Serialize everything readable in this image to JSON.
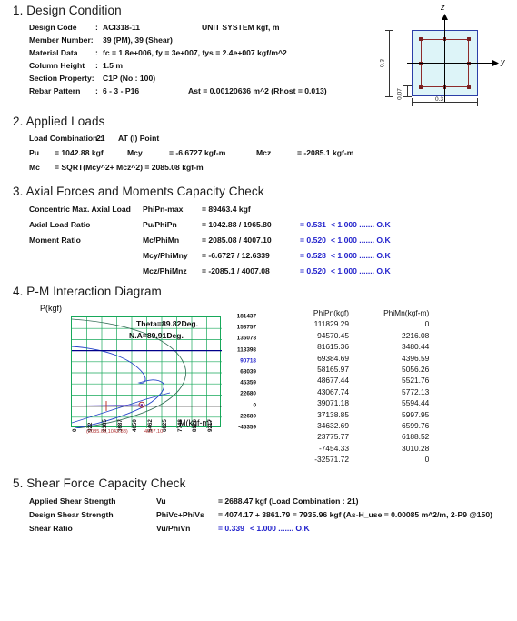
{
  "document": {
    "unit_system": "UNIT SYSTEM kgf, m"
  },
  "sections": {
    "design_condition": {
      "title": "1. Design Condition",
      "rows": [
        {
          "label": "Design Code",
          "sep": ":",
          "value": "ACI318-11"
        },
        {
          "label": "Member Number:",
          "sep": "",
          "value": "39 (PM), 39 (Shear)"
        },
        {
          "label": "Material Data",
          "sep": ":",
          "value": "fc = 1.8e+006,   fy = 3e+007,   fys = 2.4e+007 kgf/m^2"
        },
        {
          "label": "Column Height",
          "sep": ":",
          "value": "1.5 m"
        },
        {
          "label": "Section Property:",
          "sep": "",
          "value": "C1P (No : 100)"
        },
        {
          "label": "Rebar Pattern",
          "sep": ":",
          "value": "6 - 3 - P16"
        }
      ],
      "ast_text": "Ast = 0.00120636 m^2   (Rhost = 0.013)"
    },
    "applied_loads": {
      "title": "2. Applied Loads",
      "load_combination_label": "Load Combination :",
      "load_combination_value": "21",
      "at_point": "AT (I) Point",
      "pu_label": "Pu",
      "pu_value": "= 1042.88 kgf",
      "mcy_label": "Mcy",
      "mcy_value": "= -6.6727 kgf-m",
      "mcz_label": "Mcz",
      "mcz_value": "= -2085.1 kgf-m",
      "mc_label": "Mc",
      "mc_value": "= SQRT(Mcy^2+ Mcz^2) = 2085.08 kgf-m"
    },
    "axial_check": {
      "title": "3. Axial Forces and Moments Capacity Check",
      "rows": [
        {
          "label": "Concentric Max. Axial Load",
          "symbol": "PhiPn-max",
          "expr": "= 89463.4  kgf",
          "ratio": "",
          "verdict": ""
        },
        {
          "label": "Axial Load Ratio",
          "symbol": "Pu/PhiPn",
          "expr": "= 1042.88 / 1965.80",
          "ratio": "= 0.531",
          "verdict": "< 1.000 ....... O.K"
        },
        {
          "label": "Moment Ratio",
          "symbol": "Mc/PhiMn",
          "expr": "= 2085.08 / 4007.10",
          "ratio": "= 0.520",
          "verdict": "< 1.000 ....... O.K"
        },
        {
          "label": "",
          "symbol": "Mcy/PhiMny",
          "expr": "= -6.6727 / 12.6339",
          "ratio": "= 0.528",
          "verdict": "< 1.000 ....... O.K"
        },
        {
          "label": "",
          "symbol": "Mcz/PhiMnz",
          "expr": "= -2085.1 / 4007.08",
          "ratio": "= 0.520",
          "verdict": "< 1.000 ....... O.K"
        }
      ]
    },
    "pm_diagram": {
      "title": "4. P-M Interaction Diagram",
      "theta_note": "Theta=89.82Deg.",
      "na_note": "N.A=89.91Deg.",
      "point_label": "(2085.08,1042.88)",
      "capacity_label": "4007.10",
      "table_headers": [
        "PhiPn(kgf)",
        "PhiMn(kgf-m)"
      ]
    },
    "shear_check": {
      "title": "5. Shear Force Capacity Check",
      "rows": [
        {
          "label": "Applied Shear Strength",
          "symbol": "Vu",
          "value": "= 2688.47  kgf   (Load Combination :   21)",
          "ratio": "",
          "verdict": ""
        },
        {
          "label": "Design Shear Strength",
          "symbol": "PhiVc+PhiVs",
          "value": "= 4074.17 + 3861.79 = 7935.96  kgf  (As-H_use = 0.00085 m^2/m,  2-P9  @150)",
          "ratio": "",
          "verdict": ""
        },
        {
          "label": "Shear Ratio",
          "symbol": "Vu/PhiVn",
          "value": "",
          "ratio": "= 0.339",
          "verdict": "< 1.000 ....... O.K"
        }
      ]
    }
  },
  "section_figure": {
    "axis_z": "z",
    "axis_y": "y",
    "dim_height": "0.3",
    "dim_width": "0.3",
    "dim_cover": "0.07"
  },
  "chart_data": {
    "type": "line",
    "title": "P-M Interaction Diagram",
    "xlabel": "M(kgf-m)",
    "ylabel": "P(kgf)",
    "ylim": [
      -45359,
      181437
    ],
    "xlim": [
      0,
      9217
    ],
    "grid": true,
    "yticks": [
      181437,
      158757,
      136078,
      113398,
      90718,
      68039,
      45359,
      22680,
      0,
      -22680,
      -45359
    ],
    "ytick_labels": [
      "181437",
      "158757",
      "136078",
      "113398",
      "90718",
      "68039",
      "45359",
      "22680",
      "0",
      "-22680",
      "-45359"
    ],
    "xticks": [
      0,
      922,
      2185,
      3687,
      4650,
      5462,
      6825,
      7748,
      8926,
      9217
    ],
    "xtick_labels": [
      "0",
      "922",
      "2185",
      "3687",
      "4650",
      "5462",
      "6825",
      "7748",
      "8926",
      "9217"
    ],
    "annotations": [
      "Theta=89.82Deg.",
      "N.A=89.91Deg."
    ],
    "highlight_y": 89463.4,
    "demand_point": {
      "M": 2085.08,
      "P": 1042.88
    },
    "capacity_point": {
      "M": 4007.1,
      "P": 1042.88
    },
    "series": [
      {
        "name": "PhiPn-PhiMn",
        "points": [
          {
            "PhiPn": 111829.29,
            "PhiMn": 0.0
          },
          {
            "PhiPn": 94570.45,
            "PhiMn": 2216.08
          },
          {
            "PhiPn": 81615.36,
            "PhiMn": 3480.44
          },
          {
            "PhiPn": 69384.69,
            "PhiMn": 4396.59
          },
          {
            "PhiPn": 58165.97,
            "PhiMn": 5056.26
          },
          {
            "PhiPn": 48677.44,
            "PhiMn": 5521.76
          },
          {
            "PhiPn": 43067.74,
            "PhiMn": 5772.13
          },
          {
            "PhiPn": 39071.18,
            "PhiMn": 5594.44
          },
          {
            "PhiPn": 37138.85,
            "PhiMn": 5997.95
          },
          {
            "PhiPn": 34632.69,
            "PhiMn": 6599.76
          },
          {
            "PhiPn": 23775.77,
            "PhiMn": 6188.52
          },
          {
            "PhiPn": -7454.33,
            "PhiMn": 3010.28
          },
          {
            "PhiPn": -32571.72,
            "PhiMn": 0.0
          }
        ]
      }
    ]
  }
}
